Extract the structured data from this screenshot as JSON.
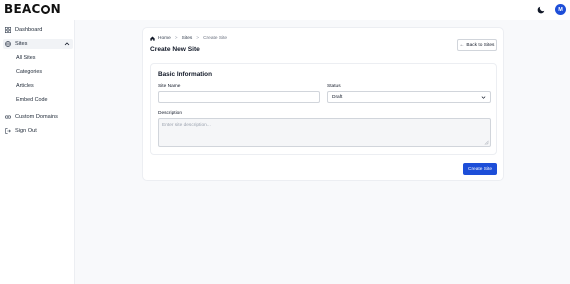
{
  "header": {
    "logo_prefix": "BEAC",
    "logo_suffix": "N",
    "avatar_initial": "M",
    "brand_color": "#1d4ed8"
  },
  "sidebar": {
    "items": [
      {
        "label": "Dashboard",
        "icon": "grid-icon"
      },
      {
        "label": "Sites",
        "icon": "globe-icon"
      },
      {
        "label": "Custom Domains",
        "icon": "link-icon"
      },
      {
        "label": "Sign Out",
        "icon": "logout-icon"
      }
    ],
    "sub_items": [
      "All Sites",
      "Categories",
      "Articles",
      "Embed Code"
    ]
  },
  "breadcrumb": [
    "Home",
    "Sites",
    "Create Site"
  ],
  "page": {
    "title": "Create New Site",
    "back_label": "Back to Sites"
  },
  "form": {
    "section_title": "Basic Information",
    "site_name_label": "Site Name",
    "site_name_value": "",
    "status_label": "Status",
    "status_value": "Draft",
    "description_label": "Description",
    "description_placeholder": "Enter site description..."
  },
  "actions": {
    "submit_label": "Create Site"
  }
}
